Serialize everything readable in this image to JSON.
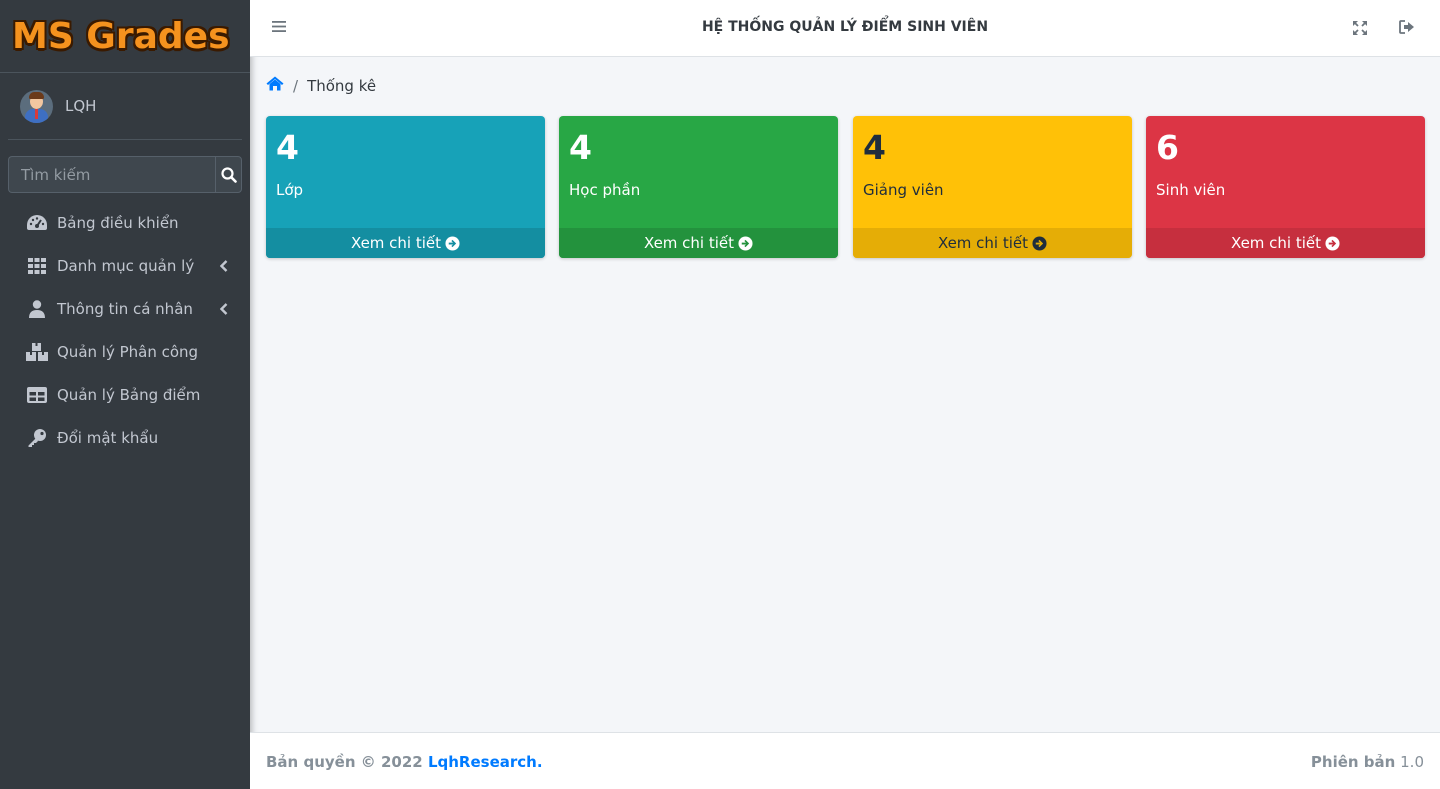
{
  "brand": {
    "name": "MS Grades"
  },
  "user": {
    "name": "LQH"
  },
  "search": {
    "placeholder": "Tìm kiếm"
  },
  "sidebar": {
    "items": [
      {
        "label": "Bảng điều khiển",
        "icon": "dashboard-icon"
      },
      {
        "label": "Danh mục quản lý",
        "icon": "grid-icon",
        "has_submenu": true
      },
      {
        "label": "Thông tin cá nhân",
        "icon": "user-icon",
        "has_submenu": true
      },
      {
        "label": "Quản lý Phân công",
        "icon": "boxes-icon"
      },
      {
        "label": "Quản lý Bảng điểm",
        "icon": "table-icon"
      },
      {
        "label": "Đổi mật khẩu",
        "icon": "key-icon"
      }
    ]
  },
  "header": {
    "title": "HỆ THỐNG QUẢN LÝ ĐIỂM SINH VIÊN"
  },
  "breadcrumb": {
    "current": "Thống kê",
    "separator": "/"
  },
  "stats": [
    {
      "value": "4",
      "label": "Lớp",
      "link": "Xem chi tiết",
      "color": "#17a2b8"
    },
    {
      "value": "4",
      "label": "Học phần",
      "link": "Xem chi tiết",
      "color": "#28a745"
    },
    {
      "value": "4",
      "label": "Giảng viên",
      "link": "Xem chi tiết",
      "color": "#ffc107"
    },
    {
      "value": "6",
      "label": "Sinh viên",
      "link": "Xem chi tiết",
      "color": "#dc3545"
    }
  ],
  "footer": {
    "copyright_prefix": "Bản quyền © 2022",
    "company": "LqhResearch.",
    "version_label": "Phiên bản",
    "version": "1.0"
  }
}
